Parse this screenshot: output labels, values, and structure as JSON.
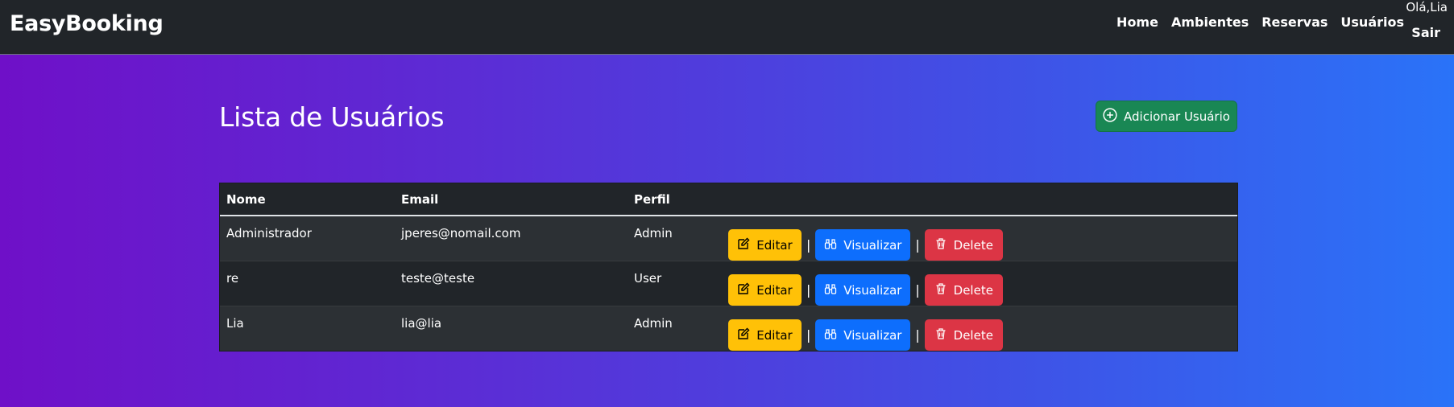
{
  "navbar": {
    "brand": "EasyBooking",
    "links": [
      {
        "label": "Home"
      },
      {
        "label": "Ambientes"
      },
      {
        "label": "Reservas"
      },
      {
        "label": "Usuários"
      }
    ],
    "greeting": "Olá,Lia",
    "logout": "Sair"
  },
  "page": {
    "title": "Lista de Usuários",
    "add_button": "Adicionar Usuário",
    "add_icon": "plus-circle-icon"
  },
  "table": {
    "headers": {
      "nome": "Nome",
      "email": "Email",
      "perfil": "Perfil"
    },
    "rows": [
      {
        "nome": "Administrador",
        "email": "jperes@nomail.com",
        "perfil": "Admin"
      },
      {
        "nome": "re",
        "email": "teste@teste",
        "perfil": "User"
      },
      {
        "nome": "Lia",
        "email": "lia@lia",
        "perfil": "Admin"
      }
    ],
    "actions": {
      "edit": "Editar",
      "view": "Visualizar",
      "delete": "Delete",
      "separator": "|"
    }
  },
  "colors": {
    "navbar": "#212529",
    "success": "#198754",
    "warning": "#ffc107",
    "primary": "#0d6efd",
    "danger": "#dc3545",
    "gradient_start": "#6f10c8",
    "gradient_end": "#2a73f8"
  }
}
